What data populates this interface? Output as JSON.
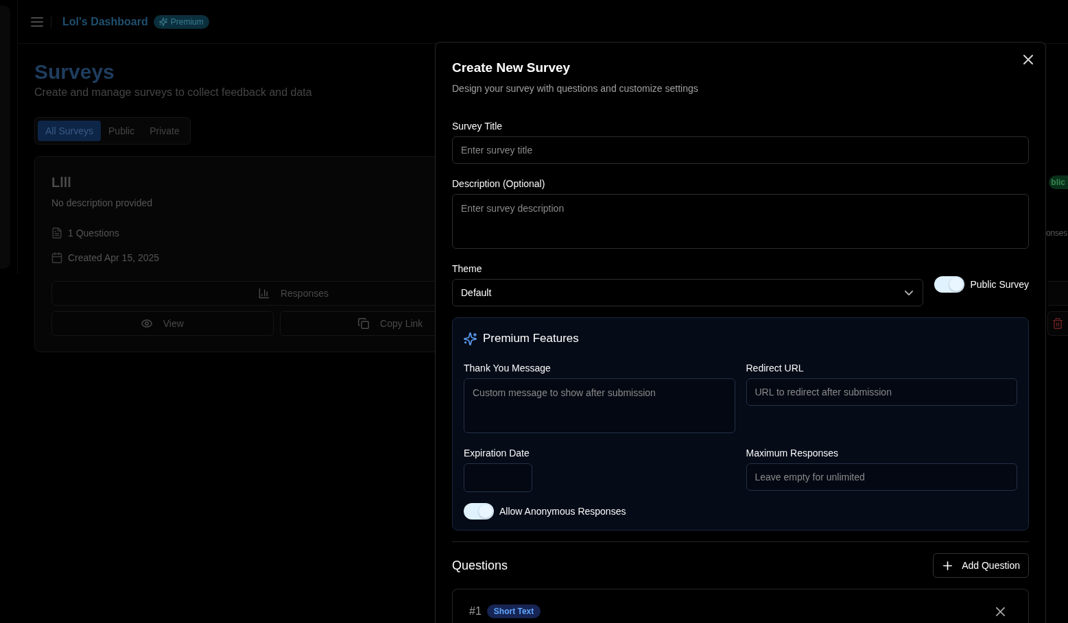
{
  "header": {
    "title": "Lol's Dashboard",
    "badge": "Premium"
  },
  "page": {
    "title": "Surveys",
    "subtitle": "Create and manage surveys to collect feedback and data"
  },
  "filter_tabs": [
    {
      "label": "All Surveys",
      "selected": true
    },
    {
      "label": "Public",
      "selected": false
    },
    {
      "label": "Private",
      "selected": false
    }
  ],
  "survey_card": {
    "title": "Llll",
    "description": "No description provided",
    "questions": "1 Questions",
    "created": "Created Apr 15, 2025",
    "responses_button": "Responses",
    "view_button": "View",
    "copy_button": "Copy Link"
  },
  "survey_card_edge": {
    "badge": "blic",
    "responses": "onses"
  },
  "dialog": {
    "title": "Create New Survey",
    "subtitle": "Design your survey with questions and customize settings",
    "fields": [
      {
        "kind": "input",
        "label": "Survey Title",
        "placeholder": "Enter survey title"
      },
      {
        "kind": "textarea",
        "label": "Description (Optional)",
        "placeholder": "Enter survey description"
      }
    ],
    "theme": {
      "label": "Theme",
      "value": "Default"
    },
    "public_switch": {
      "label": "Public Survey",
      "on": true
    },
    "premium": {
      "title": "Premium Features",
      "fields": [
        {
          "kind": "textarea",
          "label": "Thank You Message",
          "placeholder": "Custom message to show after submission"
        },
        {
          "kind": "input",
          "label": "Redirect URL",
          "placeholder": "URL to redirect after submission"
        },
        {
          "kind": "date",
          "label": "Expiration Date"
        },
        {
          "kind": "input",
          "label": "Maximum Responses",
          "placeholder": "Leave empty for unlimited"
        }
      ],
      "anonymous_switch": {
        "label": "Allow Anonymous Responses",
        "on": true
      }
    },
    "questions": {
      "title": "Questions",
      "add_button": "Add Question",
      "items": [
        {
          "number": "#1",
          "type": "Short Text"
        }
      ]
    }
  }
}
